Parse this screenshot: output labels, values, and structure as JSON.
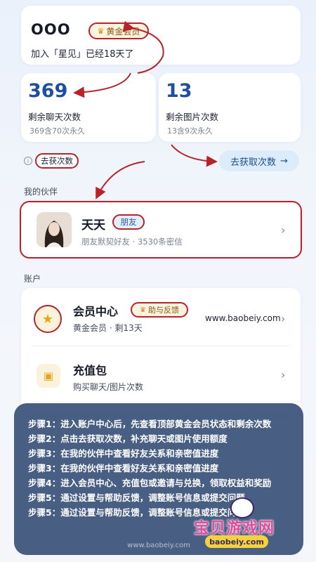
{
  "profile": {
    "username": "OOO",
    "vip_badge": "黄金会员",
    "joined_text": "加入「星见」已经18天了"
  },
  "stats": {
    "chat": {
      "value": "369",
      "label": "剩余聊天次数",
      "sub": "369含70次永久"
    },
    "image": {
      "value": "13",
      "label": "剩余图片次数",
      "sub": "13含9次永久"
    }
  },
  "get_count": {
    "link_label": "去获次数",
    "button_label": "去获取次数"
  },
  "partner": {
    "section_title": "我的伙伴",
    "name": "天天",
    "badge": "朋友",
    "desc": "朋友默契好友 · 3530条密信"
  },
  "account": {
    "section_title": "账户",
    "member_center": {
      "label": "会员中心",
      "badge": "助与反馈",
      "sub": "黄金会员 · 剩13天",
      "url": "www.baobeiy.com"
    },
    "recharge": {
      "label": "充值包",
      "sub": "购买聊天/图片次数"
    }
  },
  "steps": [
    "步骤1：进入账户中心后，先查看顶部黄金会员状态和剩余次数",
    "步骤2：点击去获取次数，补充聊天或图片使用额度",
    "步骤3：在我的伙伴中查看好友关系和亲密值进度",
    "步骤3：在我的伙伴中查看好友关系和亲密值进度",
    "步骤4：进入会员中心、充值包或邀请与兑换，领取权益和奖励",
    "步骤5：通过设置与帮助反馈，调整账号信息或提交问题",
    "步骤5：通过设置与帮助反馈，调整账号信息或提交问题"
  ],
  "footer_url": "www.baobeiy.com",
  "watermark": {
    "text": "宝贝游戏网",
    "url": "baobeiy.com"
  },
  "colors": {
    "accent_blue": "#1e4fa0",
    "annotation_red": "#b8232a",
    "steps_panel": "#3a527a"
  },
  "icons": [
    "crown-icon",
    "info-icon",
    "arrow-right-icon",
    "chevron-right-icon",
    "star-icon",
    "gift-icon",
    "thumb-icon"
  ]
}
